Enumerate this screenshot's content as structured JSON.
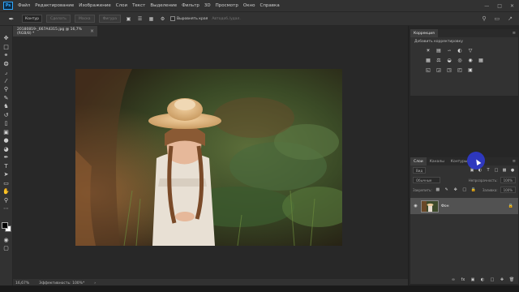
{
  "app": {
    "logo": "Ps"
  },
  "menu": [
    "Файл",
    "Редактирование",
    "Изображение",
    "Слои",
    "Текст",
    "Выделение",
    "Фильтр",
    "3D",
    "Просмотр",
    "Окно",
    "Справка"
  ],
  "options": {
    "mode": "Контур",
    "make_selection": "Сделать",
    "mask": "Маска",
    "shape": "Фигура",
    "align_edges": "Выровнять края",
    "rubber_band_label": "Автодоб./удал."
  },
  "document": {
    "tab_title": "20180819-_667A4315.jpg @ 16,7% (RGB/8) *"
  },
  "status": {
    "zoom": "16,67%",
    "efficiency": "Эффективность: 100%*"
  },
  "panels": {
    "corrections": {
      "tab": "Коррекция",
      "add_label": "Добавить корректировку"
    },
    "layers": {
      "tabs": [
        "Слои",
        "Каналы",
        "Контуры"
      ],
      "kind_label": "Вид",
      "blend_mode": "Обычные",
      "opacity_label": "Непрозрачность:",
      "opacity_value": "100%",
      "lock_label": "Закрепить:",
      "fill_label": "Заливка:",
      "fill_value": "100%",
      "layer_name": "Фон"
    }
  },
  "icons": {
    "tools": [
      "move-icon",
      "marquee-icon",
      "lasso-icon",
      "quick-select-icon",
      "crop-icon",
      "eyedropper-icon",
      "healing-icon",
      "brush-icon",
      "clone-stamp-icon",
      "history-brush-icon",
      "eraser-icon",
      "gradient-icon",
      "blur-icon",
      "dodge-icon",
      "pen-icon",
      "type-icon",
      "path-select-icon",
      "rectangle-icon",
      "hand-icon",
      "zoom-icon"
    ]
  },
  "colors": {
    "accent": "#31a8ff",
    "panel_bg": "#323232",
    "canvas_bg": "#282828",
    "cursor_highlight": "#2f3bd8"
  }
}
